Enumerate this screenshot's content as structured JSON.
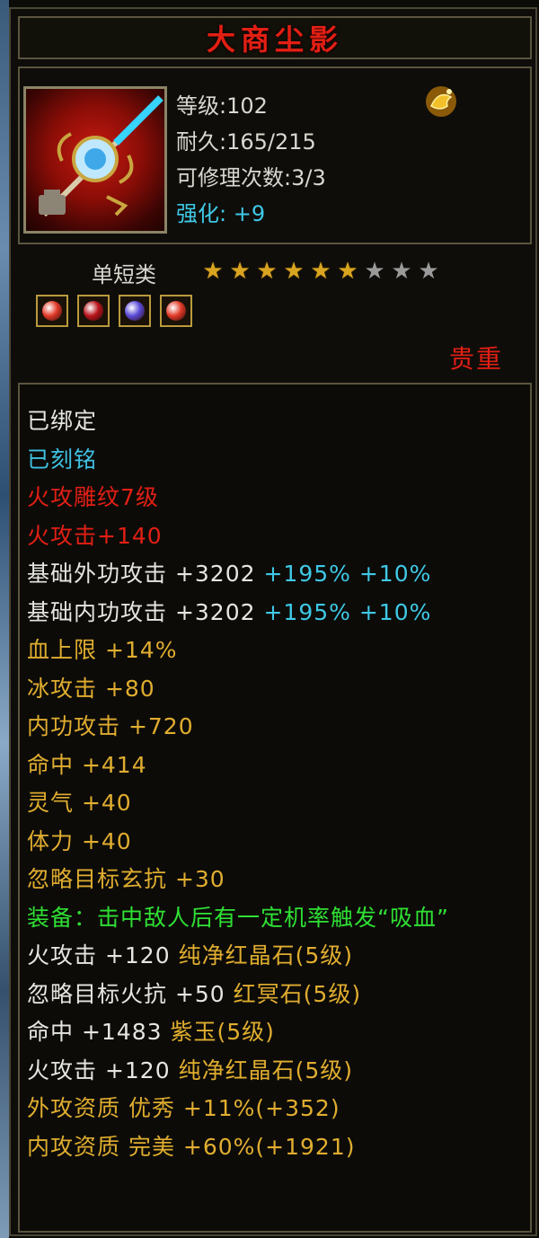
{
  "item": {
    "name": "大商尘影",
    "level_label": "等级",
    "level": "102",
    "durability_label": "耐久",
    "durability": "165/215",
    "repair_label": "可修理次数",
    "repair": "3/3",
    "enhance_label": "强化:",
    "enhance": "+9",
    "category": "单短类",
    "stars": {
      "filled": 6,
      "total": 9
    },
    "rarity": "贵重",
    "gems": [
      {
        "icon": "red-crystal-gem-icon",
        "color": "#e23a28"
      },
      {
        "icon": "red-dark-gem-icon",
        "color": "#b8141a"
      },
      {
        "icon": "purple-jade-gem-icon",
        "color": "#5a4ad8"
      },
      {
        "icon": "red-crystal-gem-icon",
        "color": "#e23a28"
      }
    ],
    "colors": {
      "title": "#e21f14",
      "white": "#e6e6e0",
      "cyan": "#3fc0e0",
      "red": "#e21f14",
      "gold": "#e0ad2f",
      "green": "#2fe034"
    }
  },
  "attributes": [
    {
      "color": "white",
      "text": "已绑定"
    },
    {
      "color": "cyan",
      "text": "已刻铭"
    },
    {
      "color": "red",
      "text": "火攻雕纹7级"
    },
    {
      "color": "red",
      "text": "火攻击+140"
    },
    {
      "color": "white",
      "text": "基础外功攻击 +3202 ",
      "extra": "+195% +10%"
    },
    {
      "color": "white",
      "text": "基础内功攻击 +3202 ",
      "extra": "+195% +10%"
    },
    {
      "color": "gold",
      "text": "血上限 +14%"
    },
    {
      "color": "gold",
      "text": "冰攻击 +80"
    },
    {
      "color": "gold",
      "text": "内功攻击 +720"
    },
    {
      "color": "gold",
      "text": "命中 +414"
    },
    {
      "color": "gold",
      "text": "灵气 +40"
    },
    {
      "color": "gold",
      "text": "体力 +40"
    },
    {
      "color": "gold",
      "text": "忽略目标玄抗 +30"
    },
    {
      "color": "green",
      "text": "装备：击中敌人后有一定机率触发“吸血”",
      "wrap": true
    },
    {
      "color": "white",
      "text": "火攻击 +120 ",
      "extra_gold": "纯净红晶石(5级)"
    },
    {
      "color": "white",
      "text": "忽略目标火抗 +50 ",
      "extra_gold": "红冥石(5级)"
    },
    {
      "color": "white",
      "text": "命中 +1483 ",
      "extra_gold": "紫玉(5级)"
    },
    {
      "color": "white",
      "text": "火攻击 +120 ",
      "extra_gold": "纯净红晶石(5级)"
    },
    {
      "color": "gold",
      "text": "外攻资质  优秀 +11%(+352)"
    },
    {
      "color": "gold",
      "text": "内攻资质  完美 +60%(+1921)"
    }
  ]
}
